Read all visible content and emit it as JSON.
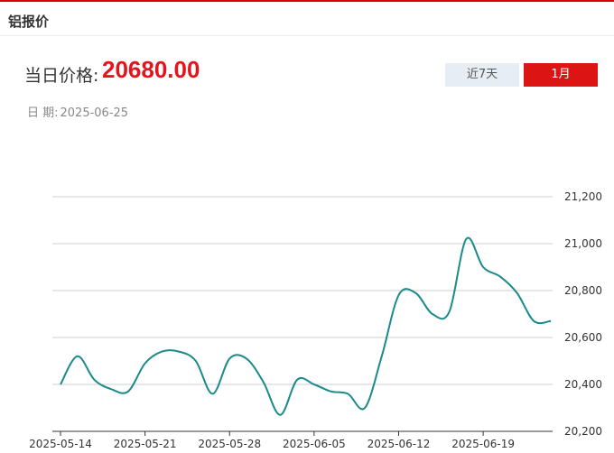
{
  "header": {
    "title": "铝报价"
  },
  "price": {
    "label": "当日价格:",
    "value": "20680.00"
  },
  "date": {
    "label": "日 期:",
    "value": "2025-06-25"
  },
  "range_buttons": {
    "week_label": "近7天",
    "month_label": "1月",
    "active": "1月"
  },
  "colors": {
    "accent": "#e3141c",
    "line": "#1a8a8a",
    "active_button": "#dd1414",
    "inactive_button": "#e6edf5"
  },
  "chart_data": {
    "type": "line",
    "title": "",
    "xlabel": "",
    "ylabel": "",
    "ylim": [
      20200,
      21200
    ],
    "yticks": [
      20200,
      20400,
      20600,
      20800,
      21000,
      21200
    ],
    "ytick_labels": [
      "20,200",
      "20,400",
      "20,600",
      "20,800",
      "21,000",
      "21,200"
    ],
    "xtick_labels": [
      "2025-05-14",
      "2025-05-21",
      "2025-05-28",
      "2025-06-05",
      "2025-06-12",
      "2025-06-19"
    ],
    "xtick_index": [
      0,
      5,
      10,
      15,
      20,
      25
    ],
    "grid": true,
    "legend": "none",
    "series": [
      {
        "values": [
          20400,
          20520,
          20420,
          20380,
          20370,
          20490,
          20540,
          20540,
          20500,
          20360,
          20510,
          20510,
          20410,
          20270,
          20420,
          20400,
          20370,
          20360,
          20300,
          20520,
          20780,
          20790,
          20700,
          20710,
          21020,
          20900,
          20860,
          20790,
          20670,
          20670
        ]
      }
    ]
  }
}
